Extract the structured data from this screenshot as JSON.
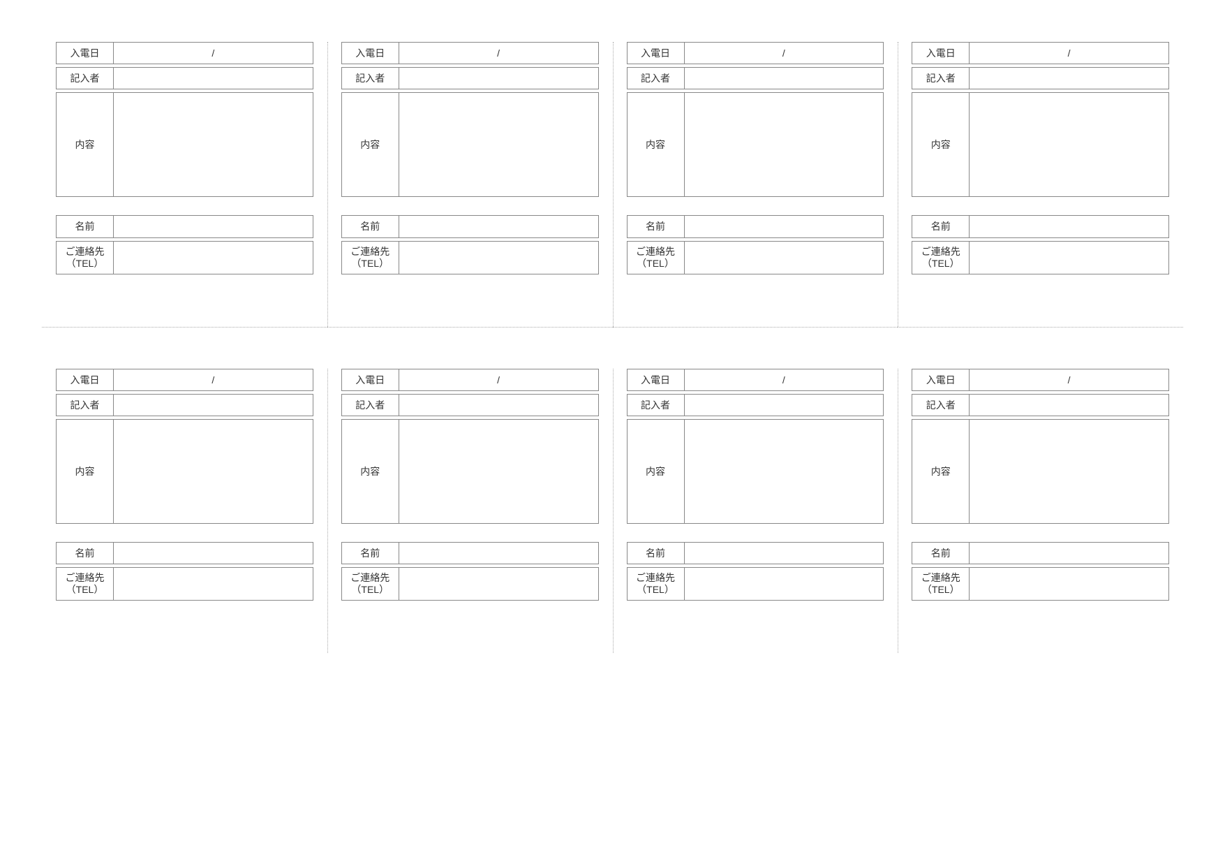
{
  "labels": {
    "date": "入電日",
    "recorder": "記入者",
    "content": "内容",
    "name": "名前",
    "contact_line1": "ご連絡先",
    "contact_line2": "（TEL）"
  },
  "cards": [
    {
      "date": "/",
      "recorder": "",
      "content": "",
      "name": "",
      "contact": ""
    },
    {
      "date": "/",
      "recorder": "",
      "content": "",
      "name": "",
      "contact": ""
    },
    {
      "date": "/",
      "recorder": "",
      "content": "",
      "name": "",
      "contact": ""
    },
    {
      "date": "/",
      "recorder": "",
      "content": "",
      "name": "",
      "contact": ""
    },
    {
      "date": "/",
      "recorder": "",
      "content": "",
      "name": "",
      "contact": ""
    },
    {
      "date": "/",
      "recorder": "",
      "content": "",
      "name": "",
      "contact": ""
    },
    {
      "date": "/",
      "recorder": "",
      "content": "",
      "name": "",
      "contact": ""
    },
    {
      "date": "/",
      "recorder": "",
      "content": "",
      "name": "",
      "contact": ""
    }
  ]
}
